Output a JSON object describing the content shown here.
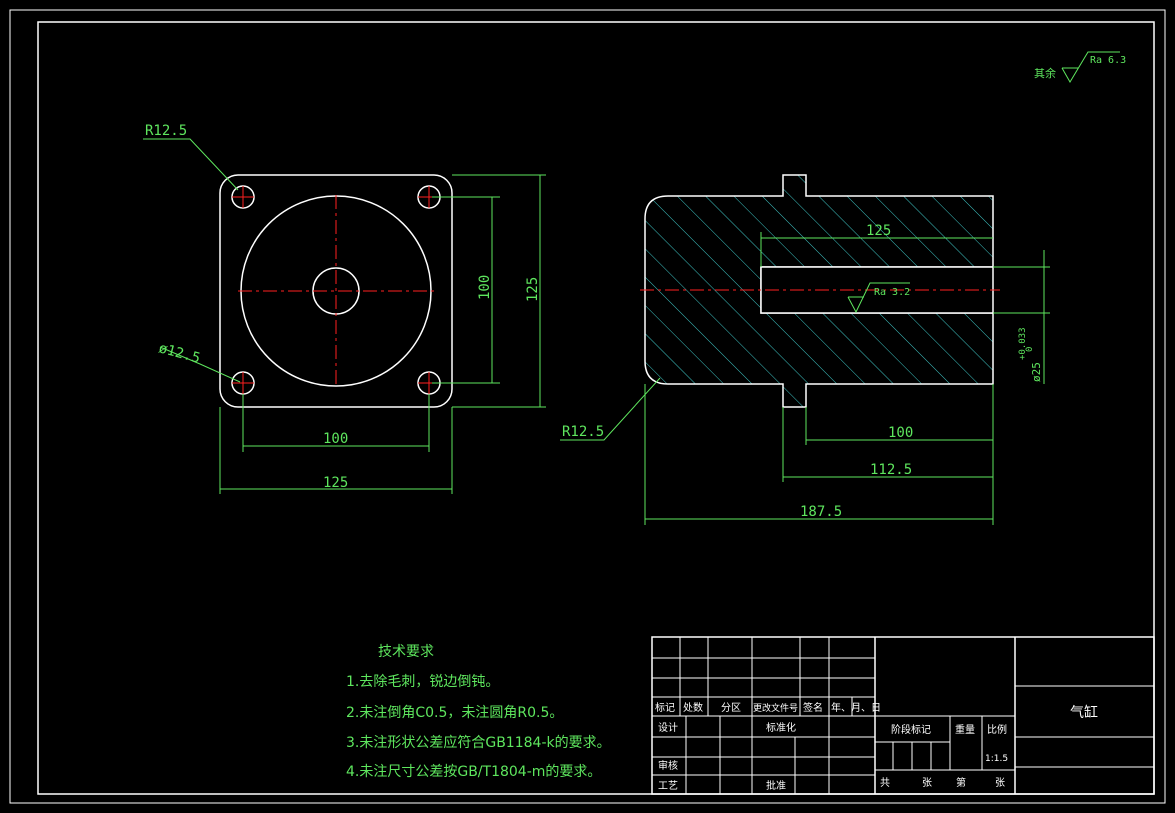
{
  "colors": {
    "background": "#000000",
    "outline": "#ffffff",
    "dimension": "#5ee65e",
    "centerline": "#ff2020",
    "hatch": "#3ec6c6"
  },
  "roughness": {
    "prefix": "其余",
    "value": "Ra 6.3",
    "bore_value": "Ra 3.2"
  },
  "front_view": {
    "corner_radius": "R12.5",
    "hole_dia": "ø12.5",
    "hole_spacing_v": "100",
    "outer_v": "125",
    "hole_spacing_h": "100",
    "outer_h": "125"
  },
  "section_view": {
    "bore_depth": "125",
    "bore_dia": "ø25",
    "bore_tol": "+0.033",
    "bore_tol_low": "0",
    "corner_radius": "R12.5",
    "dim_100": "100",
    "dim_112": "112.5",
    "dim_total": "187.5"
  },
  "notes": {
    "title": "技术要求",
    "items": [
      "1.去除毛刺，锐边倒钝。",
      "2.未注倒角C0.5，未注圆角R0.5。",
      "3.未注形状公差应符合GB1184-k的要求。",
      "4.未注尺寸公差按GB/T1804-m的要求。"
    ]
  },
  "title_block": {
    "part_name": "气缸",
    "row_labels": [
      "标记",
      "处数",
      "分区",
      "更改文件号",
      "签名",
      "年、月、日"
    ],
    "design": "设计",
    "standardize": "标准化",
    "check": "审核",
    "process": "工艺",
    "approve": "批准",
    "stage_mark": "阶段标记",
    "weight": "重量",
    "scale": "比例",
    "scale_value": "1:1.5",
    "total": "共",
    "sheet": "张",
    "number": "第",
    "sheet2": "张"
  }
}
